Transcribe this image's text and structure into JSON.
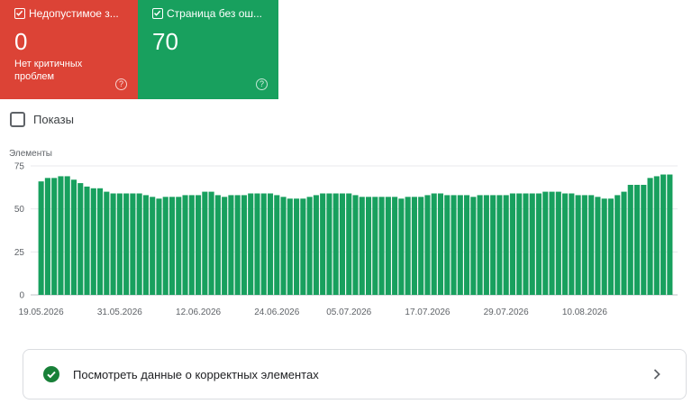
{
  "cards": [
    {
      "label": "Недопустимое з...",
      "value": "0",
      "description": "Нет критичных проблем",
      "color": "#dc4336"
    },
    {
      "label": "Страница без ош...",
      "value": "70",
      "description": "",
      "color": "#18a05e"
    }
  ],
  "help_glyph": "?",
  "impressions_toggle": {
    "label": "Показы",
    "checked": false
  },
  "chart_data": {
    "type": "bar",
    "ylabel": "Элементы",
    "ylim": [
      0,
      75
    ],
    "yticks": [
      0,
      25,
      50,
      75
    ],
    "xtick_labels": [
      "19.05.2026",
      "31.05.2026",
      "12.06.2026",
      "24.06.2026",
      "05.07.2026",
      "17.07.2026",
      "29.07.2026",
      "10.08.2026"
    ],
    "xtick_indices": [
      0,
      12,
      24,
      36,
      47,
      59,
      71,
      83
    ],
    "bar_color": "#18a05e",
    "grid": true,
    "values": [
      66,
      68,
      68,
      69,
      69,
      67,
      65,
      63,
      62,
      62,
      60,
      59,
      59,
      59,
      59,
      59,
      58,
      57,
      56,
      57,
      57,
      57,
      58,
      58,
      58,
      60,
      60,
      58,
      57,
      58,
      58,
      58,
      59,
      59,
      59,
      59,
      58,
      57,
      56,
      56,
      56,
      57,
      58,
      59,
      59,
      59,
      59,
      59,
      58,
      57,
      57,
      57,
      57,
      57,
      57,
      56,
      57,
      57,
      57,
      58,
      59,
      59,
      58,
      58,
      58,
      58,
      57,
      58,
      58,
      58,
      58,
      58,
      59,
      59,
      59,
      59,
      59,
      60,
      60,
      60,
      59,
      59,
      58,
      58,
      58,
      57,
      56,
      56,
      58,
      60,
      64,
      64,
      64,
      68,
      69,
      70,
      70
    ]
  },
  "footer": {
    "label": "Посмотреть данные о корректных элементах",
    "status_icon": "check-circle-icon",
    "chevron_icon": "chevron-right-icon"
  }
}
